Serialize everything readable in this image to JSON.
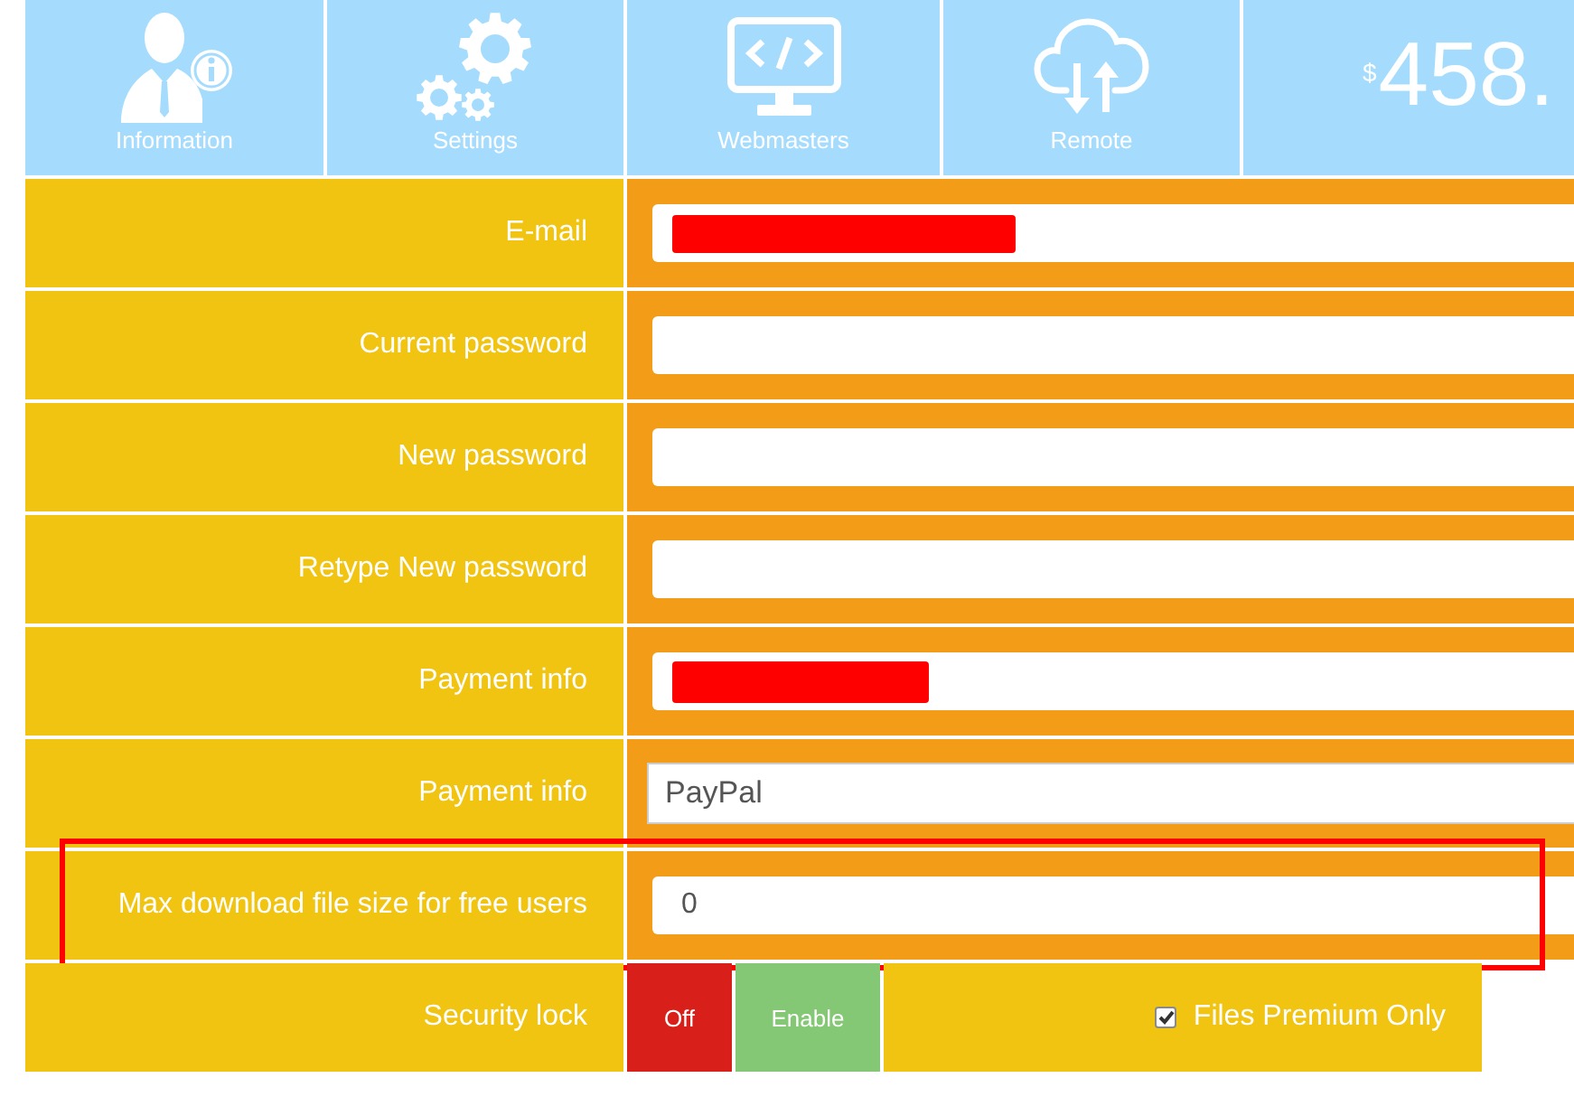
{
  "nav": {
    "tiles": [
      {
        "label": "Information"
      },
      {
        "label": "Settings"
      },
      {
        "label": "Webmasters"
      },
      {
        "label": "Remote"
      }
    ],
    "balance": {
      "currency": "$",
      "amount": "458."
    }
  },
  "fields": [
    {
      "kind": "input",
      "label": "E-mail",
      "redacted": true,
      "highlighted": false
    },
    {
      "kind": "input",
      "label": "Current password",
      "redacted": false,
      "highlighted": false
    },
    {
      "kind": "input",
      "label": "New password",
      "redacted": false,
      "highlighted": false
    },
    {
      "kind": "input",
      "label": "Retype New password",
      "redacted": false,
      "highlighted": false
    },
    {
      "kind": "input",
      "label": "Payment info",
      "redacted": true,
      "highlighted": false
    },
    {
      "kind": "select",
      "label": "Payment info",
      "value": "PayPal",
      "redacted": false,
      "highlighted": false
    },
    {
      "kind": "input",
      "label": "Max download file size for free users",
      "value": "0",
      "redacted": false,
      "highlighted": true
    }
  ],
  "security_lock": {
    "label": "Security lock",
    "buttons": [
      {
        "label": "Off",
        "color": "#d91f1a"
      },
      {
        "label": "Enable",
        "color": "#84c774"
      }
    ],
    "files_premium_only": {
      "label": "Files Premium Only",
      "checked": true
    }
  }
}
